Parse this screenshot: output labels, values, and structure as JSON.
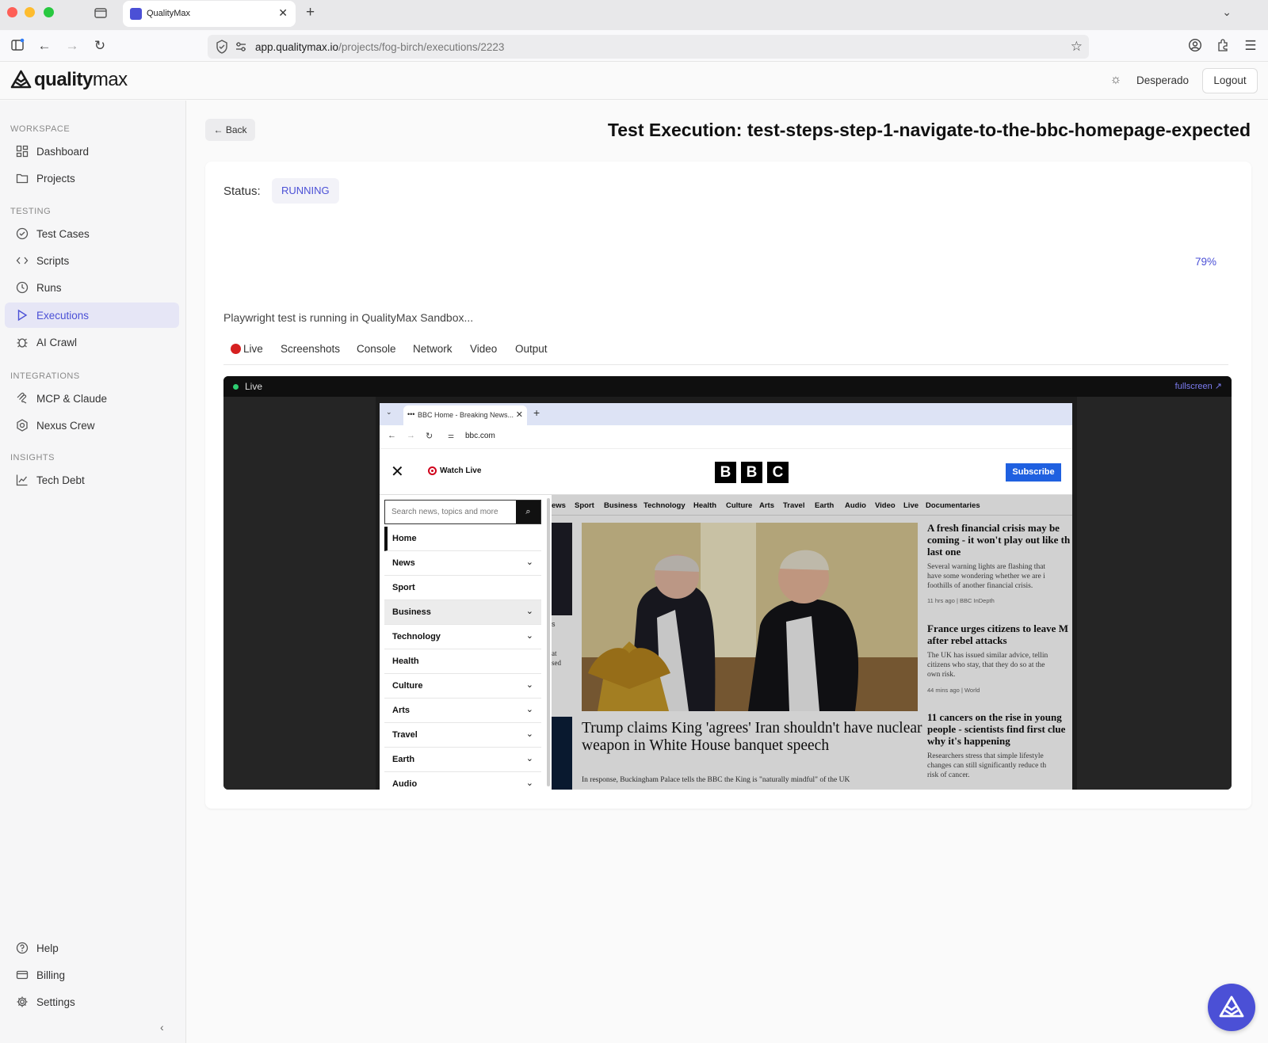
{
  "browser": {
    "tab_title": "QualityMax",
    "url_domain": "app.qualitymax.io",
    "url_path": "/projects/fog-birch/executions/2223"
  },
  "header": {
    "logo_text_bold": "quality",
    "logo_text_light": "max",
    "username": "Desperado",
    "logout_label": "Logout"
  },
  "sidebar": {
    "sections": {
      "workspace": "WORKSPACE",
      "testing": "TESTING",
      "integrations": "INTEGRATIONS",
      "insights": "INSIGHTS"
    },
    "items": {
      "dashboard": "Dashboard",
      "projects": "Projects",
      "test_cases": "Test Cases",
      "scripts": "Scripts",
      "runs": "Runs",
      "executions": "Executions",
      "ai_crawl": "AI Crawl",
      "mcp_claude": "MCP & Claude",
      "nexus_crew": "Nexus Crew",
      "tech_debt": "Tech Debt",
      "help": "Help",
      "billing": "Billing",
      "settings": "Settings"
    },
    "active_item": "executions"
  },
  "main": {
    "back_label": "← Back",
    "title": "Test Execution: test-steps-step-1-navigate-to-the-bbc-homepage-expected",
    "status_label": "Status:",
    "status_value": "RUNNING",
    "progress_text": "79%",
    "running_message": "Playwright test is running in QualityMax Sandbox...",
    "tabs": {
      "live": "Live",
      "screenshots": "Screenshots",
      "console": "Console",
      "network": "Network",
      "video": "Video",
      "output": "Output"
    },
    "active_tab": "live"
  },
  "viewer": {
    "live_label": "Live",
    "fullscreen_label": "fullscreen ↗",
    "status_dot_color": "#2ecc71"
  },
  "remote_browser": {
    "tab_title": "BBC Home - Breaking News...",
    "url": "bbc.com",
    "watch_live": "Watch Live",
    "logo_letters": [
      "B",
      "B",
      "C"
    ],
    "subscribe": "Subscribe",
    "search_placeholder": "Search news, topics and more",
    "menu": [
      {
        "label": "Home",
        "has_chevron": false
      },
      {
        "label": "News",
        "has_chevron": true
      },
      {
        "label": "Sport",
        "has_chevron": false
      },
      {
        "label": "Business",
        "has_chevron": true
      },
      {
        "label": "Technology",
        "has_chevron": true
      },
      {
        "label": "Health",
        "has_chevron": false
      },
      {
        "label": "Culture",
        "has_chevron": true
      },
      {
        "label": "Arts",
        "has_chevron": true
      },
      {
        "label": "Travel",
        "has_chevron": true
      },
      {
        "label": "Earth",
        "has_chevron": true
      },
      {
        "label": "Audio",
        "has_chevron": true
      }
    ],
    "nav": [
      "ews",
      "Sport",
      "Business",
      "Technology",
      "Health",
      "Culture",
      "Arts",
      "Travel",
      "Earth",
      "Audio",
      "Video",
      "Live",
      "Documentaries"
    ],
    "lead_headline": "Trump claims King 'agrees' Iran shouldn't have nuclear weapon in White House banquet speech",
    "lead_sub": "In response, Buckingham Palace tells the BBC the King is \"naturally mindful\" of the UK",
    "stories": [
      {
        "headline_lines": [
          "A fresh financial crisis may be",
          "coming - it won't play out like th",
          "last one"
        ],
        "body_lines": [
          "Several warning lights are flashing that",
          "have some wondering whether we are i",
          "foothills of another financial crisis."
        ],
        "meta": "11 hrs ago  |  BBC InDepth"
      },
      {
        "headline_lines": [
          "France urges citizens to leave M",
          "after rebel attacks"
        ],
        "body_lines": [
          "The UK has issued similar advice, tellin",
          "citizens who stay, that they do so at the",
          "own risk."
        ],
        "meta": "44 mins ago  |  World"
      },
      {
        "headline_lines": [
          "11 cancers on the rise in young",
          "people - scientists find first clue",
          "why it's happening"
        ],
        "body_lines": [
          "Researchers stress that simple lifestyle",
          "changes can still significantly reduce th",
          "risk of cancer."
        ],
        "meta": ""
      }
    ],
    "side_fragments": [
      "s",
      "at",
      "sed"
    ]
  },
  "colors": {
    "accent": "#4b50d6",
    "bbc_blue": "#1f60e0",
    "live_red": "#d62020"
  }
}
